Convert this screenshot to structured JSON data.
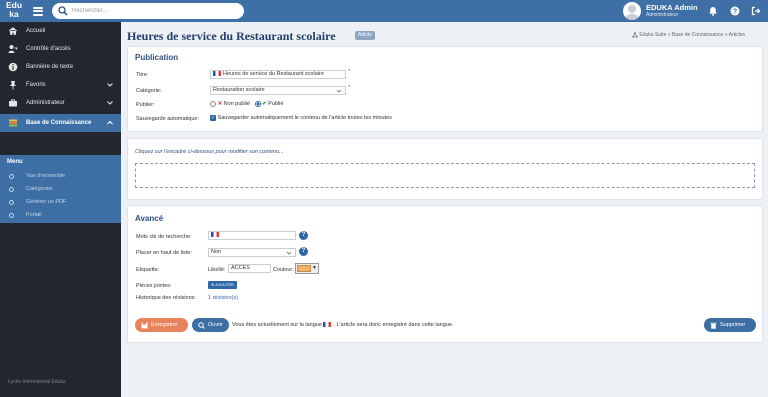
{
  "app": {
    "logo": "Edu ka",
    "logo_line1": "Edu",
    "logo_line2": "ka"
  },
  "search": {
    "placeholder": "Rechercher..."
  },
  "user": {
    "name": "EDUKA Admin",
    "role": "Administrateur"
  },
  "sidebar": {
    "items": [
      {
        "label": "Accueil",
        "icon": "home-icon"
      },
      {
        "label": "Contrôle d'accès",
        "icon": "user-key-icon"
      },
      {
        "label": "Bannière de texte",
        "icon": "info-icon"
      },
      {
        "label": "Favoris",
        "icon": "pin-icon",
        "chevron": "chevron-down"
      },
      {
        "label": "Administrateur",
        "icon": "briefcase-icon",
        "chevron": "chevron-down"
      },
      {
        "label": "Base de Connaissance",
        "icon": "books-icon",
        "chevron": "chevron-up",
        "active": true
      }
    ],
    "menu_title": "Menu",
    "menu_items": [
      "Vue d'ensemble",
      "Catégories",
      "Générer un PDF",
      "Portail"
    ],
    "footer": "Lycée International Eduka"
  },
  "page": {
    "title": "Heures de service du Restaurant scolaire",
    "badge": "Article",
    "breadcrumb": "Eduka Suite » Base de Connaissance » Articles"
  },
  "publication": {
    "heading": "Publication",
    "title_label": "Titre:",
    "title_value": "Heures de service du Restaurant scolaire",
    "category_label": "Catégorie:",
    "category_value": "Restauration scolaire",
    "publish_label": "Publier:",
    "unpublished": "Non publié",
    "published": "Publié",
    "autosave_label": "Sauvegarde automatique:",
    "autosave_text": "Sauvegarder automatiquement le contenu de l'article toutes les minutes",
    "autosave_checked": true
  },
  "editor": {
    "hint": "Cliquez sur l'encadré ci-dessous pour modifier son contenu..."
  },
  "advanced": {
    "heading": "Avancé",
    "keywords_label": "Mots clé de recherche:",
    "pin_label": "Placer en haut de liste:",
    "pin_value": "Non",
    "tag_label": "Etiquette:",
    "libelle_label": "Libellé:",
    "libelle_value": "ACCÈS",
    "couleur_label": "Couleur:",
    "tag_color": "#f0b46e",
    "attachments_label": "Pièces jointes:",
    "add_label": "AJOUTER",
    "history_label": "Historique des révisions:",
    "history_value": "1 révision(s)"
  },
  "actions": {
    "save": "Enregistrer",
    "open": "Ouvrir",
    "lang_notice_before": "Vous êtes actuellement sur la langue",
    "lang_notice_after": ". L'article sera donc enregistré dans cette langue.",
    "delete": "Supprimer"
  },
  "colors": {
    "topbar": "#3e6fa6",
    "sidebar": "#22262e",
    "accent": "#3d6fa5",
    "save": "#e8825a",
    "danger_x": "#e03030",
    "check": "#2e9e4a"
  }
}
